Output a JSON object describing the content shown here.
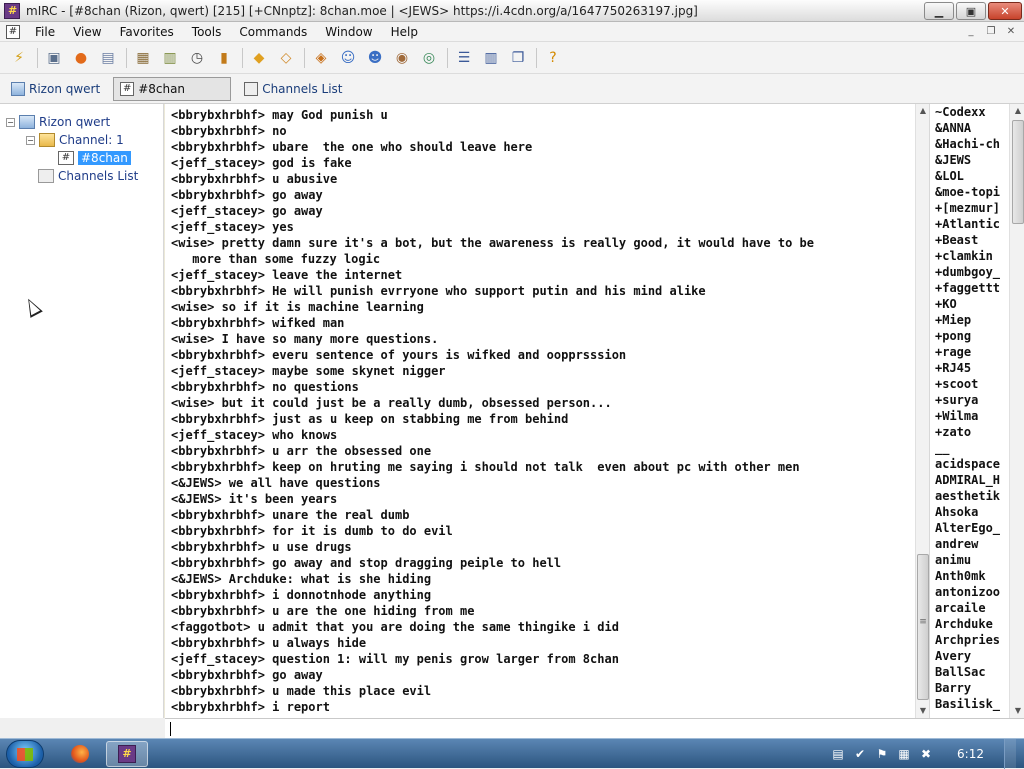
{
  "window": {
    "title": "mIRC - [#8chan (Rizon, qwert) [215] [+CNnptz]: 8chan.moe | <JEWS> https://i.4cdn.org/a/1647750263197.jpg]",
    "min_glyph": "▁",
    "max_glyph": "▣",
    "close_glyph": "✕"
  },
  "menu": {
    "mdi_icon": "#",
    "items": [
      "File",
      "View",
      "Favorites",
      "Tools",
      "Commands",
      "Window",
      "Help"
    ],
    "mdi_controls": [
      "_",
      "❐",
      "✕"
    ]
  },
  "toolbar": {
    "buttons": [
      {
        "name": "connect-icon",
        "glyph": "⚡",
        "color": "#d4a017"
      },
      {
        "name": "options-icon",
        "glyph": "▣",
        "color": "#5a6f8c"
      },
      {
        "name": "address-book-icon",
        "glyph": "●",
        "color": "#e26a1a"
      },
      {
        "name": "channels-list-icon",
        "glyph": "▤",
        "color": "#6b7fa3"
      },
      {
        "name": "scripts-editor-icon",
        "glyph": "▦",
        "color": "#8a6d3b"
      },
      {
        "name": "logs-icon",
        "glyph": "▥",
        "color": "#7a8a3b"
      },
      {
        "name": "timer-icon",
        "glyph": "◷",
        "color": "#4a4a4a"
      },
      {
        "name": "colors-icon",
        "glyph": "▮",
        "color": "#c27a1a"
      },
      {
        "name": "send-file-icon",
        "glyph": "◆",
        "color": "#e0a020"
      },
      {
        "name": "received-files-icon",
        "glyph": "◇",
        "color": "#d08a2a"
      },
      {
        "name": "notify-icon",
        "glyph": "◈",
        "color": "#c8701a"
      },
      {
        "name": "dcc-chat-icon",
        "glyph": "☺",
        "color": "#3b6fc4"
      },
      {
        "name": "dcc-send-icon",
        "glyph": "☻",
        "color": "#3b6fc4"
      },
      {
        "name": "url-list-icon",
        "glyph": "◉",
        "color": "#a06a3a"
      },
      {
        "name": "online-help-icon",
        "glyph": "◎",
        "color": "#3a8a5a"
      },
      {
        "name": "tile-horizontal-icon",
        "glyph": "☰",
        "color": "#3b5998"
      },
      {
        "name": "tile-vertical-icon",
        "glyph": "▥",
        "color": "#3b5998"
      },
      {
        "name": "cascade-icon",
        "glyph": "❐",
        "color": "#3b5998"
      },
      {
        "name": "help-icon",
        "glyph": "?",
        "color": "#d48a00"
      }
    ]
  },
  "switchbar": {
    "server_label": "Rizon qwert",
    "channel_label": "#8chan",
    "channels_list_label": "Channels List",
    "hash_glyph": "#"
  },
  "tree": {
    "expand_glyph": "−",
    "server": "Rizon qwert",
    "channel_group": "Channel: 1",
    "channel": "#8chan",
    "channels_list": "Channels List",
    "hash_glyph": "#"
  },
  "chat": {
    "lines": [
      "<bbrybxhrbhf> may God punish u",
      "<bbrybxhrbhf> no",
      "<bbrybxhrbhf> ubare  the one who should leave here",
      "<jeff_stacey> god is fake",
      "<bbrybxhrbhf> u abusive",
      "<bbrybxhrbhf> go away",
      "<jeff_stacey> go away",
      "<jeff_stacey> yes",
      "<wise> pretty damn sure it's a bot, but the awareness is really good, it would have to be",
      " more than some fuzzy logic",
      "<jeff_stacey> leave the internet",
      "<bbrybxhrbhf> He will punish evrryone who support putin and his mind alike",
      "<wise> so if it is machine learning",
      "<bbrybxhrbhf> wifked man",
      "<wise> I have so many more questions.",
      "<bbrybxhrbhf> everu sentence of yours is wifked and oopprsssion",
      "<jeff_stacey> maybe some skynet nigger",
      "<bbrybxhrbhf> no questions",
      "<wise> but it could just be a really dumb, obsessed person...",
      "<bbrybxhrbhf> just as u keep on stabbing me from behind",
      "<jeff_stacey> who knows",
      "<bbrybxhrbhf> u arr the obsessed one",
      "<bbrybxhrbhf> keep on hruting me saying i should not talk  even about pc with other men",
      "<&JEWS> we all have questions",
      "<&JEWS> it's been years",
      "<bbrybxhrbhf> unare the real dumb",
      "<bbrybxhrbhf> for it is dumb to do evil",
      "<bbrybxhrbhf> u use drugs",
      "<bbrybxhrbhf> go away and stop dragging peiple to hell",
      "<&JEWS> Archduke: what is she hiding",
      "<bbrybxhrbhf> i donnotnhode anything",
      "<bbrybxhrbhf> u are the one hiding from me",
      "<faggotbot> u admit that you are doing the same thingike i did",
      "<bbrybxhrbhf> u always hide",
      "<jeff_stacey> question 1: will my penis grow larger from 8chan",
      "<bbrybxhrbhf> go away",
      "<bbrybxhrbhf> u made this place evil",
      "<bbrybxhrbhf> i report"
    ]
  },
  "nicklist": {
    "nicks": [
      "~Codexx",
      "&ANNA",
      "&Hachi-ch",
      "&JEWS",
      "&LOL",
      "&moe-topi",
      "+[mezmur]",
      "+Atlantic",
      "+Beast",
      "+clamkin",
      "+dumbgoy_",
      "+faggettt",
      "+KO",
      "+Miep",
      "+pong",
      "+rage",
      "+RJ45",
      "+scoot",
      "+surya",
      "+Wilma",
      "+zato",
      "__",
      "acidspace",
      "ADMIRAL_H",
      "aesthetik",
      "Ahsoka",
      "AlterEgo_",
      "andrew",
      "animu",
      "Anth0mk",
      "antonizoo",
      "arcaile",
      "Archduke",
      "Archpries",
      "Avery",
      "BallSac",
      "Barry",
      "Basilisk_"
    ]
  },
  "scrollbar": {
    "up_glyph": "▲",
    "down_glyph": "▼",
    "grip_glyph": "≡"
  },
  "taskbar": {
    "clock": "6:12",
    "mirc_glyph": "#",
    "tray_icons": [
      {
        "name": "action-center-icon",
        "glyph": "▤"
      },
      {
        "name": "security-icon",
        "glyph": "✔"
      },
      {
        "name": "flag-icon",
        "glyph": "⚑"
      },
      {
        "name": "network-icon",
        "glyph": "▦"
      },
      {
        "name": "volume-muted-icon",
        "glyph": "✖"
      }
    ]
  }
}
